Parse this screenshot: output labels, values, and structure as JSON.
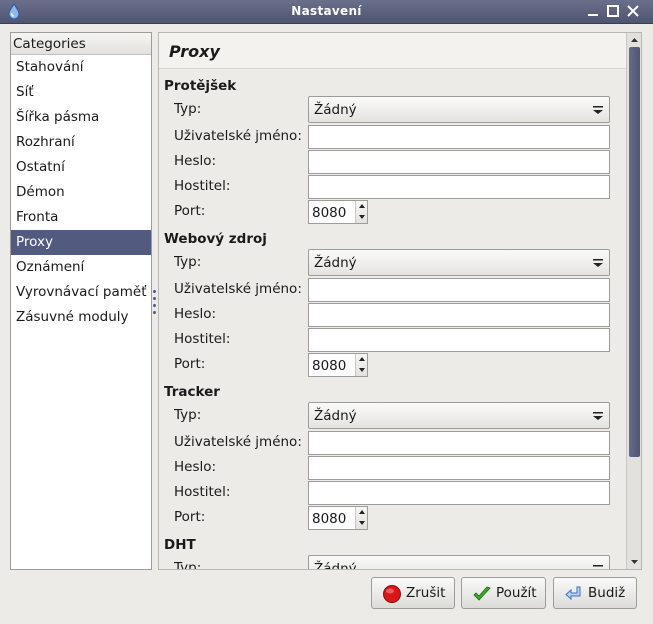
{
  "window": {
    "title": "Nastavení",
    "minimize_icon": "minimize-icon",
    "maximize_icon": "maximize-icon",
    "close_icon": "close-icon"
  },
  "categories": {
    "header": "Categories",
    "items": [
      "Stahování",
      "Síť",
      "Šířka pásma",
      "Rozhraní",
      "Ostatní",
      "Démon",
      "Fronta",
      "Proxy",
      "Oznámení",
      "Vyrovnávací paměť",
      "Zásuvné moduly"
    ],
    "selected": "Proxy"
  },
  "page": {
    "title": "Proxy"
  },
  "sections": [
    {
      "heading": "Protějšek",
      "type_label": "Typ:",
      "type_value": "Žádný",
      "username_label": "Uživatelské jméno:",
      "password_label": "Heslo:",
      "host_label": "Hostitel:",
      "port_label": "Port:",
      "port_value": "8080"
    },
    {
      "heading": "Webový zdroj",
      "type_label": "Typ:",
      "type_value": "Žádný",
      "username_label": "Uživatelské jméno:",
      "password_label": "Heslo:",
      "host_label": "Hostitel:",
      "port_label": "Port:",
      "port_value": "8080"
    },
    {
      "heading": "Tracker",
      "type_label": "Typ:",
      "type_value": "Žádný",
      "username_label": "Uživatelské jméno:",
      "password_label": "Heslo:",
      "host_label": "Hostitel:",
      "port_label": "Port:",
      "port_value": "8080"
    },
    {
      "heading": "DHT",
      "type_label": "Typ:",
      "type_value": "Žádný"
    }
  ],
  "buttons": {
    "cancel": "Zrušit",
    "apply": "Použít",
    "ok": "Budiž"
  },
  "colors": {
    "titlebar": "#5a5f7c",
    "selection": "#535a80",
    "scroll_thumb": "#5a6080",
    "cancel_icon": "#d81818",
    "apply_icon": "#3caa2a",
    "ok_icon": "#3b6fc0"
  }
}
